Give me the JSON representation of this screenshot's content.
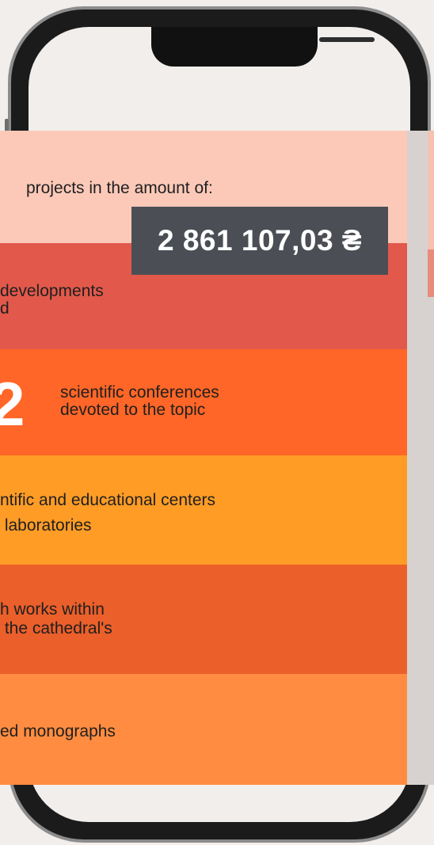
{
  "phone": {
    "icons": [
      "notch-icon",
      "camera-icon"
    ]
  },
  "colors": {
    "band1": "#fcc9b8",
    "band2": "#e2594b",
    "band3": "#ff6627",
    "band4": "#ff9c26",
    "band5": "#eb5f2a",
    "band6": "#ff8c40",
    "amount_bg": "#4b4f55"
  },
  "stats": {
    "projects": {
      "text": "projects in the amount of:",
      "amount": "2 861 107,03 ₴"
    },
    "developments": {
      "line1": "developments",
      "line2": "d"
    },
    "conferences": {
      "number": "2",
      "line1": "scientific conferences",
      "line2": "devoted to the topic"
    },
    "centers": {
      "line1": "ntific and educational centers",
      "line2": " laboratories"
    },
    "works": {
      "line1": "h works within",
      "line2": " the cathedral's"
    },
    "monographs": {
      "line1": "ed monographs"
    }
  }
}
